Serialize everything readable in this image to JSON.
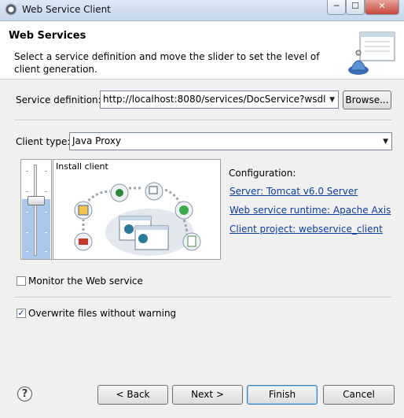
{
  "window": {
    "title": "Web Service Client",
    "minimize_glyph": "─",
    "maximize_glyph": "☐",
    "close_glyph": "✕"
  },
  "header": {
    "title": "Web Services",
    "description": "Select a service definition and move the slider to set the level of client generation."
  },
  "service_definition": {
    "label": "Service definition:",
    "value": "http://localhost:8080/services/DocService?wsdl",
    "browse_label": "Browse..."
  },
  "client_type": {
    "label": "Client type:",
    "value": "Java Proxy"
  },
  "slider": {
    "level_caption": "Install client",
    "level_fraction": 0.6
  },
  "configuration": {
    "heading": "Configuration:",
    "links": [
      "Server: Tomcat v6.0 Server",
      "Web service runtime: Apache Axis",
      "Client project: webservice_client"
    ]
  },
  "options": {
    "monitor_label": "Monitor the Web service",
    "monitor_checked": false,
    "overwrite_label": "Overwrite files without warning",
    "overwrite_checked": true,
    "check_glyph": "✓"
  },
  "footer": {
    "help_glyph": "?",
    "back_label": "< Back",
    "next_label": "Next >",
    "finish_label": "Finish",
    "cancel_label": "Cancel"
  },
  "icons": [
    "app-icon",
    "wizard-banner-icon",
    "help-icon",
    "dropdown-arrow-icon"
  ],
  "colors": {
    "link": "#0b3ea3",
    "slider_fill": "#a9c8ec",
    "default_button_border": "#3c7fb1"
  }
}
